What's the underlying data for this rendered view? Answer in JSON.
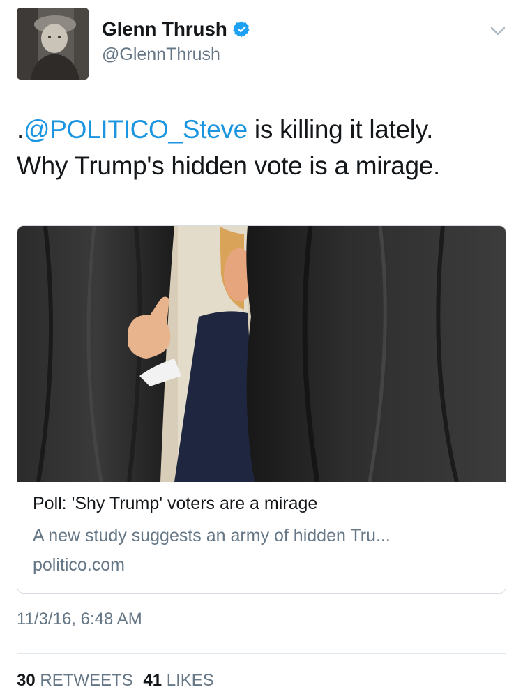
{
  "author": {
    "display_name": "Glenn Thrush",
    "handle": "@GlennThrush",
    "verified": true,
    "verified_icon": "verified-badge-icon",
    "menu_icon": "chevron-down-icon"
  },
  "tweet": {
    "prefix": ".",
    "mention": "@POLITICO_Steve",
    "text_after_mention": " is killing it lately.",
    "line2": "Why Trump's hidden vote is a mirage."
  },
  "card": {
    "image_alt": "photo",
    "title": "Poll: 'Shy Trump' voters are a mirage",
    "description": "A new study suggests an army of hidden Tru...",
    "domain": "politico.com"
  },
  "timestamp": "11/3/16, 6:48 AM",
  "stats": {
    "retweets_count": "30",
    "retweets_label": "RETWEETS",
    "likes_count": "41",
    "likes_label": "LIKES"
  },
  "colors": {
    "link": "#1b95e0",
    "secondary_text": "#657786",
    "primary_text": "#14171a",
    "border": "#d7dde2"
  }
}
